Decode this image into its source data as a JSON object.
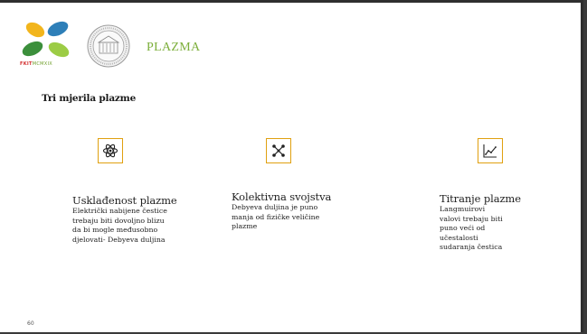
{
  "header": {
    "logo_text_red": "FKIT",
    "logo_text_green": "MCMXIX",
    "title": "PLAZMA"
  },
  "section_title": "Tri mjerila plazme",
  "criteria": [
    {
      "heading": "Usklađenost plazme",
      "lines": [
        "Električki nabijene čestice",
        "trebaju biti dovoljno blizu",
        "da bi mogle međusobno",
        "djelovati-  Debyeva duljina"
      ],
      "icon": "atom-icon"
    },
    {
      "heading": "Kolektivna svojstva",
      "lines": [
        "Debyeva duljina je puno",
        "manja od fizičke veličine",
        "plazme"
      ],
      "icon": "network-icon"
    },
    {
      "heading": "Titranje plazme",
      "lines": [
        "Langmuirovi",
        "valovi trebaju biti",
        "puno veći od",
        "učestalosti",
        "sudaranja čestica"
      ],
      "icon": "line-chart-icon"
    }
  ],
  "page_number": "60",
  "colors": {
    "accent_green": "#7cae3a",
    "icon_border": "#e0a010",
    "logo_red": "#d32f2f"
  }
}
